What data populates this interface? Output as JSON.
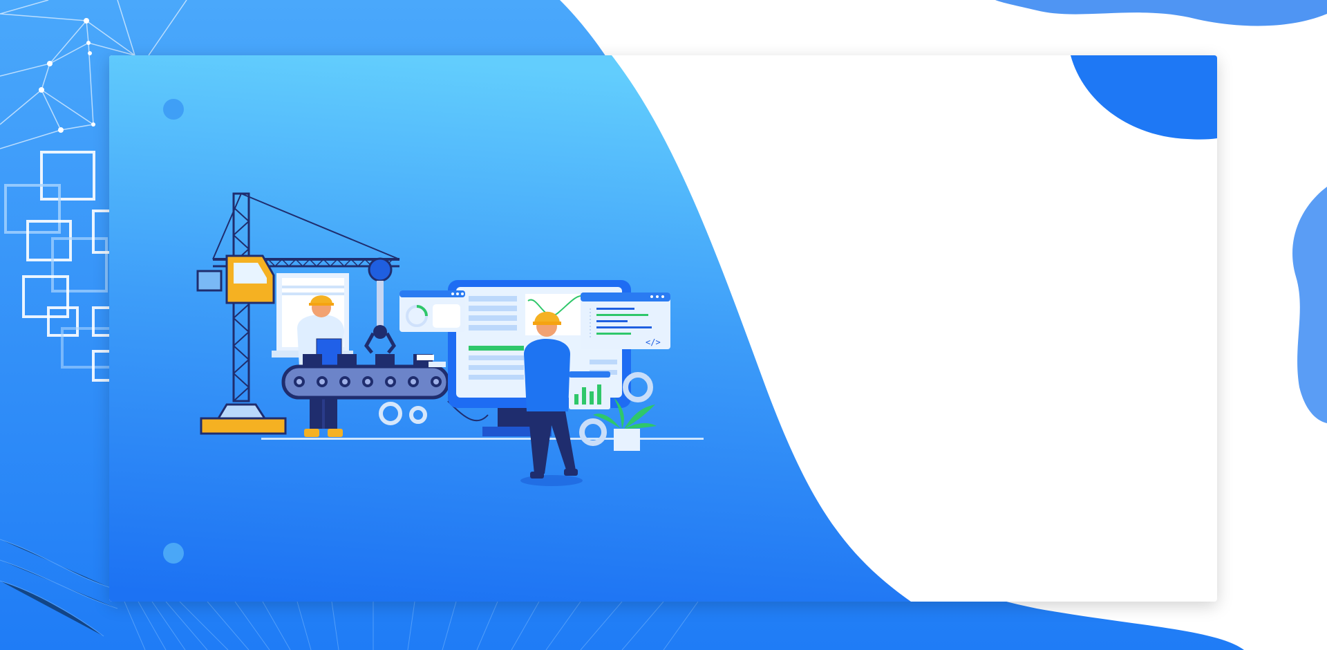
{
  "banner": {
    "illustration": {
      "description_icon": "factory-automation-illustration",
      "code_panel_text": "</>"
    },
    "colors": {
      "primary_blue": "#2a84f7",
      "light_blue": "#63cdfd",
      "deep_blue": "#1d6ff2",
      "accent_orange": "#f5b122",
      "accent_green": "#2fc76a",
      "navy": "#1f2d6e"
    }
  }
}
